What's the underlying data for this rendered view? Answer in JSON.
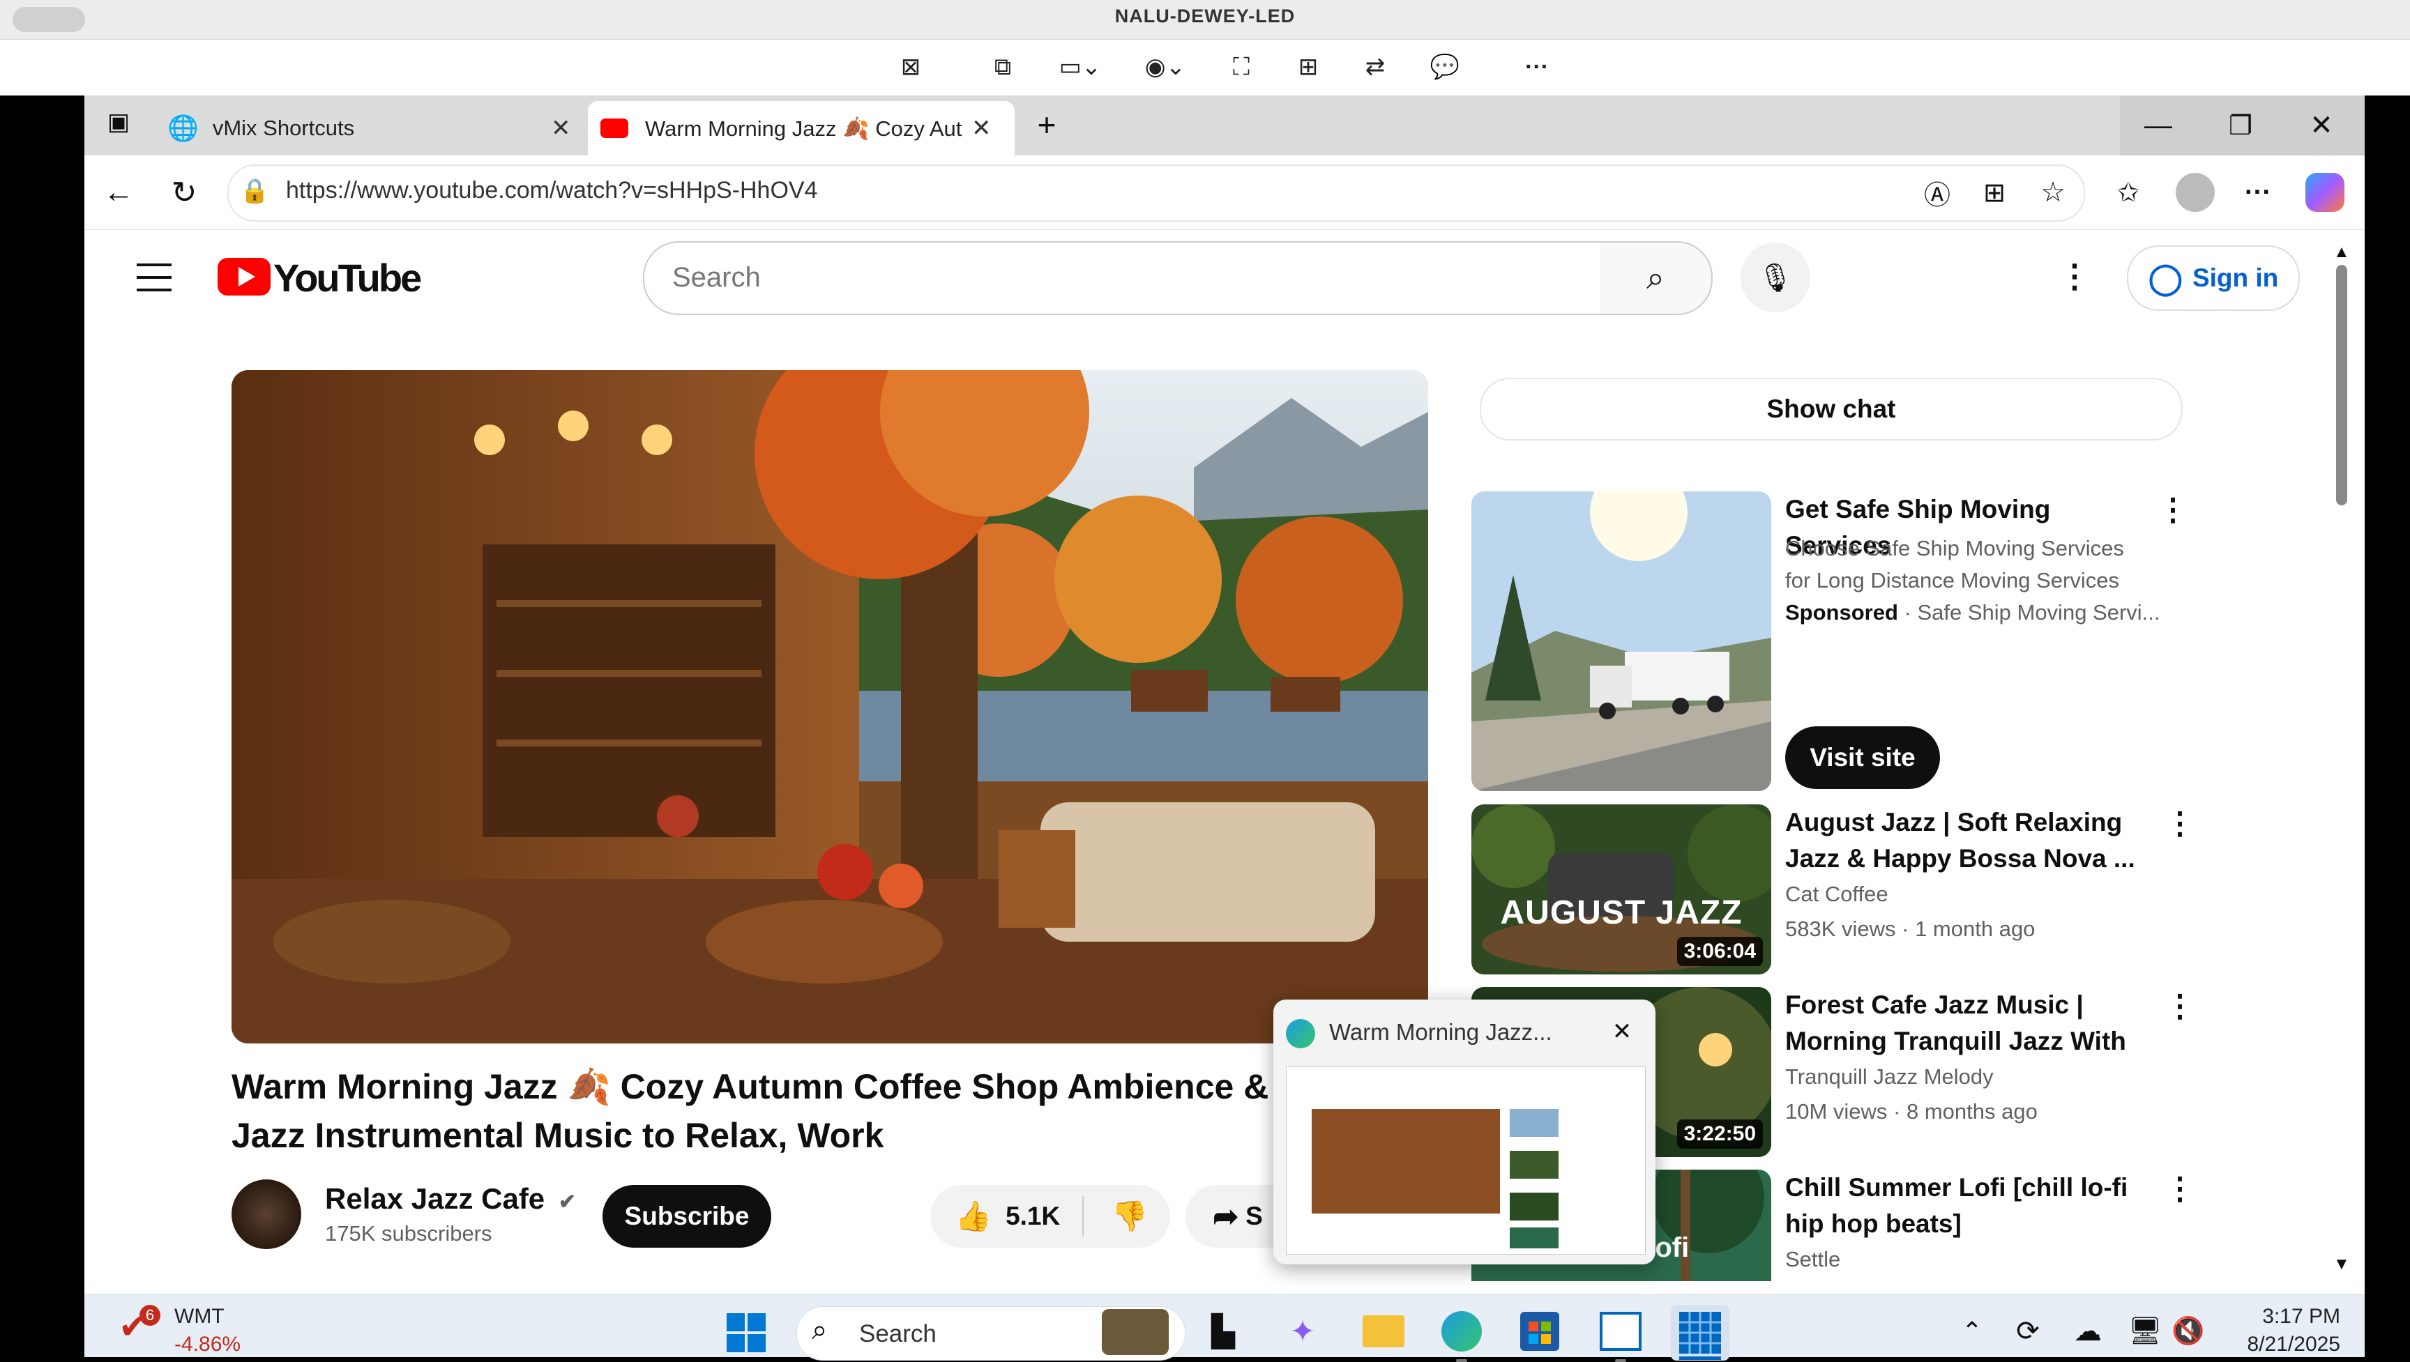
{
  "remote": {
    "title": "NALU-DEWEY-LED",
    "toolbar": [
      "close-session-icon",
      "remote-display-icon",
      "monitor-icon",
      "eye-icon",
      "fullscreen-icon",
      "multi-monitor-icon",
      "switch-icon",
      "chat-icon",
      "more-icon"
    ]
  },
  "browser": {
    "tabs": [
      {
        "label": "vMix Shortcuts",
        "icon": "globe-icon"
      },
      {
        "label": "Warm Morning Jazz 🍂 Cozy Aut",
        "icon": "youtube-icon"
      }
    ],
    "url": "https://www.youtube.com/watch?v=sHHpS-HhOV4",
    "new_tab": "+"
  },
  "youtube": {
    "logo_text": "YouTube",
    "search_placeholder": "Search",
    "sign_in": "Sign in",
    "show_chat": "Show chat",
    "video": {
      "title_line1": "Warm Morning Jazz 🍂 Cozy Autumn Coffee Shop Ambience & S",
      "title_line2": "Jazz Instrumental Music to Relax, Work",
      "channel": "Relax Jazz Cafe",
      "subscribers": "175K subscribers",
      "subscribe_label": "Subscribe",
      "likes": "5.1K",
      "share_label": "S"
    },
    "ad": {
      "title": "Get Safe Ship Moving Services",
      "desc_line1": "Choose Safe Ship Moving Services",
      "desc_line2": "for Long Distance Moving Services",
      "sponsored": "Sponsored",
      "advertiser": " · Safe Ship Moving Servi...",
      "cta": "Visit site"
    },
    "related": [
      {
        "title": "August Jazz | Soft Relaxing Jazz & Happy Bossa Nova ...",
        "channel": "Cat Coffee",
        "meta": "583K views · 1 month ago",
        "duration": "3:06:04",
        "thumb_text": "AUGUST JAZZ"
      },
      {
        "title": "Forest Cafe Jazz Music | Morning Tranquill Jazz With ...",
        "channel": "Tranquill Jazz Melody",
        "meta": "10M views · 8 months ago",
        "duration": "3:22:50",
        "thumb_text": ""
      },
      {
        "title": "Chill Summer Lofi [chill lo-fi hip hop beats]",
        "channel": "Settle",
        "meta": "",
        "duration": "",
        "thumb_text": "er Lofi"
      }
    ]
  },
  "preview": {
    "title": "Warm Morning Jazz..."
  },
  "taskbar": {
    "stock_badge": "6",
    "stock_name": "WMT",
    "stock_change": "-4.86%",
    "search_label": "Search",
    "time": "3:17 PM",
    "date": "8/21/2025",
    "colors": {
      "negative": "#c42b1c",
      "accent": "#0067c0"
    }
  }
}
